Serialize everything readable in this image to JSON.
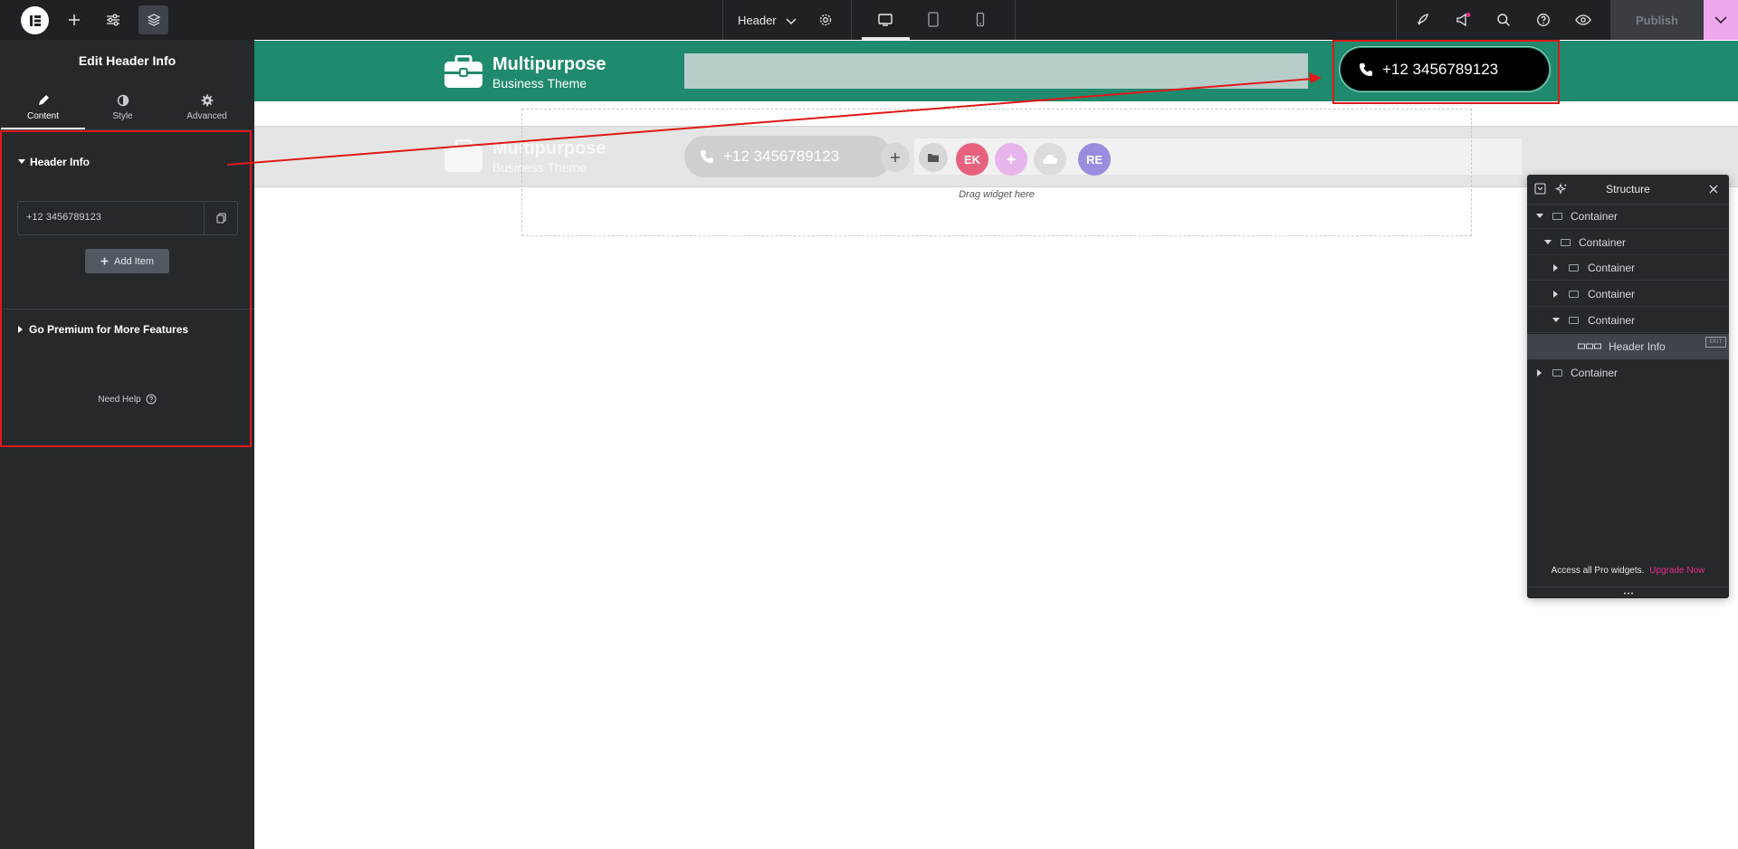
{
  "topbar": {
    "document_name": "Header",
    "publish_label": "Publish"
  },
  "panel": {
    "title": "Edit Header Info",
    "tabs": [
      {
        "label": "Content",
        "icon": "pencil-icon",
        "active": true
      },
      {
        "label": "Style",
        "icon": "half-circle-icon",
        "active": false
      },
      {
        "label": "Advanced",
        "icon": "gear-icon",
        "active": false
      }
    ],
    "section_header_info": "Header Info",
    "item_value": "+12 3456789123",
    "add_item_label": "Add Item",
    "section_premium": "Go Premium for More Features",
    "need_help_label": "Need Help"
  },
  "canvas": {
    "logo_title": "Multipurpose",
    "logo_subtitle": "Business Theme",
    "phone_button_text": "+12 3456789123",
    "ghost_phone_text": "+12 3456789123",
    "drag_hint": "Drag widget here",
    "quick_add_icons": [
      "plus-icon",
      "folder-icon",
      "ek-icon",
      "ai-sparkle-icon",
      "cloud-icon",
      "re-icon"
    ],
    "ek_label": "EK",
    "re_label": "RE"
  },
  "structure": {
    "title": "Structure",
    "rows": [
      {
        "label": "Container"
      },
      {
        "label": "Container"
      },
      {
        "label": "Container"
      },
      {
        "label": "Container"
      },
      {
        "label": "Container"
      },
      {
        "label": "Header Info"
      },
      {
        "label": "Container"
      }
    ],
    "badge": "EKIT",
    "footer_text": "Access all Pro widgets.",
    "footer_link": "Upgrade Now"
  },
  "colors": {
    "header_green": "#1f8a6d",
    "annotation_red": "#e01818",
    "accent_pink": "#e72b8a",
    "panel_dark": "#26292c"
  }
}
